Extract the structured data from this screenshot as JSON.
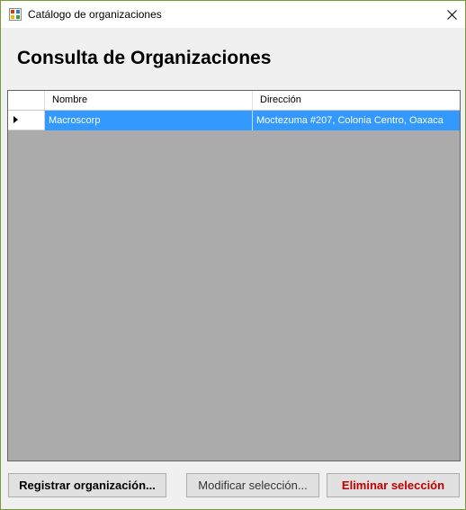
{
  "window": {
    "title": "Catálogo de organizaciones",
    "close_glyph": "✕"
  },
  "page": {
    "title": "Consulta de Organizaciones"
  },
  "grid": {
    "columns": [
      "Nombre",
      "Dirección"
    ],
    "rows": [
      {
        "nombre": "Macroscorp",
        "direccion": "Moctezuma #207, Colonia Centro, Oaxaca"
      }
    ]
  },
  "buttons": {
    "register_label": "Registrar organización...",
    "modify_label": "Modificar selección...",
    "delete_label": "Eliminar selección"
  },
  "colors": {
    "selection": "#3399ff",
    "grid_background": "#ababab",
    "delete_text": "#c00000"
  },
  "icons": {
    "app": "app-window-icon",
    "close": "close-icon",
    "row_indicator": "current-row-arrow-icon"
  }
}
